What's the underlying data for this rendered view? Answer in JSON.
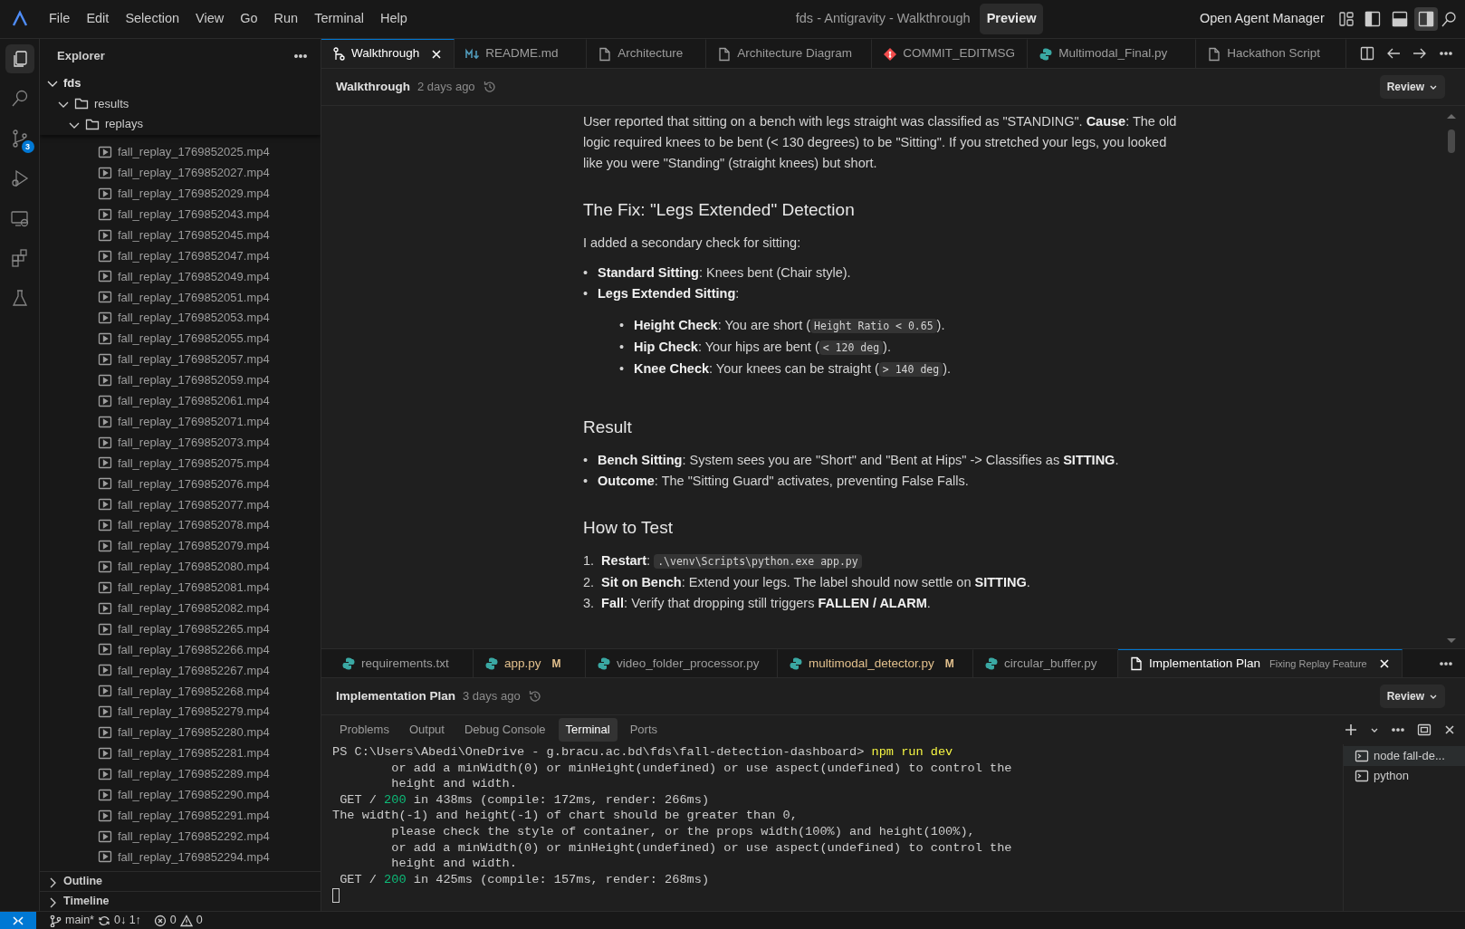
{
  "title_bar": {
    "menu": [
      "File",
      "Edit",
      "Selection",
      "View",
      "Go",
      "Run",
      "Terminal",
      "Help"
    ],
    "title": "fds - Antigravity - Walkthrough",
    "badge": "Preview",
    "agent_button": "Open Agent Manager",
    "layout_buttons": [
      {
        "kind": "customize",
        "selected": false
      },
      {
        "kind": "primary_sidebar",
        "selected": false
      },
      {
        "kind": "panel",
        "selected": false
      },
      {
        "kind": "secondary_sidebar",
        "selected": true
      }
    ]
  },
  "activity_bar": [
    {
      "kind": "files",
      "selected": true
    },
    {
      "kind": "search",
      "selected": false
    },
    {
      "kind": "source_control",
      "selected": false,
      "badge": "3"
    },
    {
      "kind": "run",
      "selected": false
    },
    {
      "kind": "remote",
      "selected": false
    },
    {
      "kind": "extensions",
      "selected": false
    },
    {
      "kind": "testing",
      "selected": false
    }
  ],
  "sidebar": {
    "title": "Explorer",
    "tree": [
      {
        "label": "fds",
        "kind": "root",
        "expanded": true,
        "children": [
          {
            "label": "results",
            "kind": "folder",
            "expanded": true,
            "children": [
              {
                "label": "replays",
                "kind": "folder",
                "expanded": true,
                "children": [
                  {
                    "label": "fall_replay_1769852025.mp4",
                    "kind": "video"
                  },
                  {
                    "label": "fall_replay_1769852027.mp4",
                    "kind": "video"
                  },
                  {
                    "label": "fall_replay_1769852029.mp4",
                    "kind": "video"
                  },
                  {
                    "label": "fall_replay_1769852043.mp4",
                    "kind": "video"
                  },
                  {
                    "label": "fall_replay_1769852045.mp4",
                    "kind": "video"
                  },
                  {
                    "label": "fall_replay_1769852047.mp4",
                    "kind": "video"
                  },
                  {
                    "label": "fall_replay_1769852049.mp4",
                    "kind": "video"
                  },
                  {
                    "label": "fall_replay_1769852051.mp4",
                    "kind": "video"
                  },
                  {
                    "label": "fall_replay_1769852053.mp4",
                    "kind": "video"
                  },
                  {
                    "label": "fall_replay_1769852055.mp4",
                    "kind": "video"
                  },
                  {
                    "label": "fall_replay_1769852057.mp4",
                    "kind": "video"
                  },
                  {
                    "label": "fall_replay_1769852059.mp4",
                    "kind": "video"
                  },
                  {
                    "label": "fall_replay_1769852061.mp4",
                    "kind": "video"
                  },
                  {
                    "label": "fall_replay_1769852071.mp4",
                    "kind": "video"
                  },
                  {
                    "label": "fall_replay_1769852073.mp4",
                    "kind": "video"
                  },
                  {
                    "label": "fall_replay_1769852075.mp4",
                    "kind": "video"
                  },
                  {
                    "label": "fall_replay_1769852076.mp4",
                    "kind": "video"
                  },
                  {
                    "label": "fall_replay_1769852077.mp4",
                    "kind": "video"
                  },
                  {
                    "label": "fall_replay_1769852078.mp4",
                    "kind": "video"
                  },
                  {
                    "label": "fall_replay_1769852079.mp4",
                    "kind": "video"
                  },
                  {
                    "label": "fall_replay_1769852080.mp4",
                    "kind": "video"
                  },
                  {
                    "label": "fall_replay_1769852081.mp4",
                    "kind": "video"
                  },
                  {
                    "label": "fall_replay_1769852082.mp4",
                    "kind": "video"
                  },
                  {
                    "label": "fall_replay_1769852265.mp4",
                    "kind": "video"
                  },
                  {
                    "label": "fall_replay_1769852266.mp4",
                    "kind": "video"
                  },
                  {
                    "label": "fall_replay_1769852267.mp4",
                    "kind": "video"
                  },
                  {
                    "label": "fall_replay_1769852268.mp4",
                    "kind": "video"
                  },
                  {
                    "label": "fall_replay_1769852279.mp4",
                    "kind": "video"
                  },
                  {
                    "label": "fall_replay_1769852280.mp4",
                    "kind": "video"
                  },
                  {
                    "label": "fall_replay_1769852281.mp4",
                    "kind": "video"
                  },
                  {
                    "label": "fall_replay_1769852289.mp4",
                    "kind": "video"
                  },
                  {
                    "label": "fall_replay_1769852290.mp4",
                    "kind": "video"
                  },
                  {
                    "label": "fall_replay_1769852291.mp4",
                    "kind": "video"
                  },
                  {
                    "label": "fall_replay_1769852292.mp4",
                    "kind": "video"
                  },
                  {
                    "label": "fall_replay_1769852294.mp4",
                    "kind": "video"
                  }
                ]
              }
            ]
          }
        ]
      }
    ],
    "sections": [
      {
        "label": "Outline",
        "expanded": false
      },
      {
        "label": "Timeline",
        "expanded": false
      }
    ]
  },
  "editor_tabs": [
    {
      "label": "Walkthrough",
      "kind": "walkthrough",
      "selected": true
    },
    {
      "label": "README.md",
      "kind": "markdown",
      "selected": false
    },
    {
      "label": "Architecture",
      "kind": "document",
      "selected": false
    },
    {
      "label": "Architecture Diagram",
      "kind": "document",
      "selected": false
    },
    {
      "label": "COMMIT_EDITMSG",
      "kind": "git",
      "selected": false
    },
    {
      "label": "Multimodal_Final.py",
      "kind": "python",
      "selected": false
    },
    {
      "label": "Hackathon Script",
      "kind": "document",
      "selected": false
    }
  ],
  "breadcrumb": {
    "title": "Walkthrough",
    "time": "2 days ago",
    "review": "Review"
  },
  "document": [
    {
      "kind": "paragraph",
      "parts": [
        {
          "kind": "text",
          "text": "User reported that sitting on a bench with legs straight was classified as \"STANDING\". **Cause**: The old logic required knees to be bent (< 130 degrees) to be \"Sitting\". If you stretched your legs, you looked like you were \"Standing\" (straight knees) but short."
        }
      ]
    },
    {
      "kind": "heading",
      "text": "The Fix: \"Legs Extended\" Detection"
    },
    {
      "kind": "paragraph",
      "parts": [
        {
          "kind": "text",
          "text": "I added a secondary check for sitting:"
        }
      ]
    },
    {
      "kind": "bullets",
      "items": [
        {
          "marker": "•",
          "parts": [
            {
              "kind": "text",
              "text": "**Standard Sitting**: Knees bent (Chair style)."
            }
          ]
        },
        {
          "marker": "•",
          "parts": [
            {
              "kind": "text",
              "text": "**Legs Extended Sitting**:"
            }
          ],
          "children": [
            {
              "marker": "•",
              "parts": [
                {
                  "kind": "text",
                  "text": "**Height Check**: You are short ("
                },
                {
                  "kind": "code",
                  "text": "Height Ratio < 0.65"
                },
                {
                  "kind": "text",
                  "text": ")."
                }
              ]
            },
            {
              "marker": "•",
              "parts": [
                {
                  "kind": "text",
                  "text": "**Hip Check**: Your hips are bent ("
                },
                {
                  "kind": "code",
                  "text": "< 120 deg"
                },
                {
                  "kind": "text",
                  "text": ")."
                }
              ]
            },
            {
              "marker": "•",
              "parts": [
                {
                  "kind": "text",
                  "text": "**Knee Check**: Your knees can be straight ("
                },
                {
                  "kind": "code",
                  "text": "> 140 deg"
                },
                {
                  "kind": "text",
                  "text": ")."
                }
              ]
            }
          ]
        }
      ]
    },
    {
      "kind": "heading",
      "text": "Result"
    },
    {
      "kind": "bullets",
      "items": [
        {
          "marker": "•",
          "parts": [
            {
              "kind": "text",
              "text": "**Bench Sitting**: System sees you are \"Short\" and \"Bent at Hips\" -> Classifies as **SITTING**."
            }
          ]
        },
        {
          "marker": "•",
          "parts": [
            {
              "kind": "text",
              "text": "**Outcome**: The \"Sitting Guard\" activates, preventing False Falls."
            }
          ]
        }
      ]
    },
    {
      "kind": "heading",
      "text": "How to Test"
    },
    {
      "kind": "numbered",
      "items": [
        {
          "marker": "1.",
          "parts": [
            {
              "kind": "text",
              "text": "**Restart**: "
            },
            {
              "kind": "code",
              "text": ".\\venv\\Scripts\\python.exe app.py"
            }
          ]
        },
        {
          "marker": "2.",
          "parts": [
            {
              "kind": "text",
              "text": "**Sit on Bench**: Extend your legs. The label should now settle on **SITTING**."
            }
          ]
        },
        {
          "marker": "3.",
          "parts": [
            {
              "kind": "text",
              "text": "**Fall**: Verify that dropping still triggers **FALLEN / ALARM**."
            }
          ]
        }
      ]
    }
  ],
  "bottom_tabs": [
    {
      "label": "requirements.txt",
      "kind": "python",
      "selected": false,
      "modified": false
    },
    {
      "label": "app.py",
      "kind": "python",
      "selected": false,
      "modified": true,
      "badge": "M"
    },
    {
      "label": "video_folder_processor.py",
      "kind": "python",
      "selected": false,
      "modified": false
    },
    {
      "label": "multimodal_detector.py",
      "kind": "python",
      "selected": false,
      "modified": true,
      "badge": "M"
    },
    {
      "label": "circular_buffer.py",
      "kind": "python",
      "selected": false,
      "modified": false
    },
    {
      "label": "Implementation Plan",
      "kind": "document",
      "selected": true,
      "modified": false,
      "subtitle": "Fixing Replay Feature"
    }
  ],
  "plan_bar": {
    "title": "Implementation Plan",
    "time": "3 days ago",
    "review": "Review"
  },
  "panel": {
    "tabs": [
      {
        "label": "Problems",
        "selected": false
      },
      {
        "label": "Output",
        "selected": false
      },
      {
        "label": "Debug Console",
        "selected": false
      },
      {
        "label": "Terminal",
        "selected": true
      },
      {
        "label": "Ports",
        "selected": false
      }
    ],
    "terminal": [
      {
        "kind": "prompt",
        "text": "PS C:\\Users\\Abedi\\OneDrive - g.bracu.ac.bd\\fds\\fall-detection-dashboard> ",
        "command": "npm run dev"
      },
      {
        "kind": "output",
        "text": "        or add a minWidth(0) or minHeight(undefined) or use aspect(undefined) to control the"
      },
      {
        "kind": "output",
        "text": "        height and width."
      },
      {
        "kind": "request",
        "text": " GET / ",
        "status": "200",
        "rest": " in 438ms (compile: 172ms, render: 266ms)"
      },
      {
        "kind": "output",
        "text": "The width(-1) and height(-1) of chart should be greater than 0,"
      },
      {
        "kind": "output",
        "text": "        please check the style of container, or the props width(100%) and height(100%),"
      },
      {
        "kind": "output",
        "text": "        or add a minWidth(0) or minHeight(undefined) or use aspect(undefined) to control the"
      },
      {
        "kind": "output",
        "text": "        height and width."
      },
      {
        "kind": "request",
        "text": " GET / ",
        "status": "200",
        "rest": " in 425ms (compile: 157ms, render: 268ms)"
      }
    ],
    "sessions": [
      {
        "label": "node fall-de...",
        "selected": true
      },
      {
        "label": "python",
        "selected": false
      }
    ]
  },
  "status_bar": {
    "branch": "main*",
    "sync": "0↓ 1↑",
    "errors": "0",
    "warnings": "0"
  }
}
